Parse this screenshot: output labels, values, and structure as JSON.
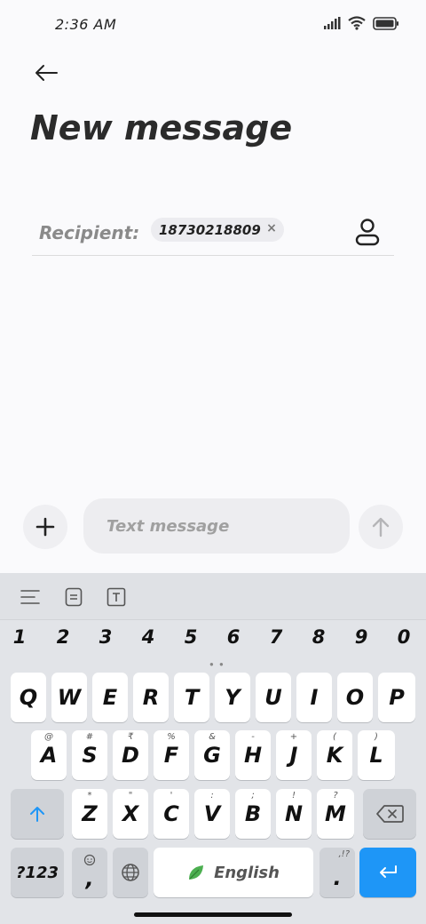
{
  "status_bar": {
    "time": "2:36 AM"
  },
  "header": {
    "title": "New message"
  },
  "recipient": {
    "label": "Recipient:",
    "chip_number": "18730218809",
    "chip_remove": "×"
  },
  "compose": {
    "placeholder": "Text message"
  },
  "keyboard": {
    "numbers": [
      "1",
      "2",
      "3",
      "4",
      "5",
      "6",
      "7",
      "8",
      "9",
      "0"
    ],
    "row1": [
      {
        "k": "Q",
        "s": ""
      },
      {
        "k": "W",
        "s": ""
      },
      {
        "k": "E",
        "s": ""
      },
      {
        "k": "R",
        "s": ""
      },
      {
        "k": "T",
        "s": ""
      },
      {
        "k": "Y",
        "s": ""
      },
      {
        "k": "U",
        "s": ""
      },
      {
        "k": "I",
        "s": ""
      },
      {
        "k": "O",
        "s": ""
      },
      {
        "k": "P",
        "s": ""
      }
    ],
    "row2": [
      {
        "k": "A",
        "s": "@"
      },
      {
        "k": "S",
        "s": "#"
      },
      {
        "k": "D",
        "s": "₹"
      },
      {
        "k": "F",
        "s": "%"
      },
      {
        "k": "G",
        "s": "&"
      },
      {
        "k": "H",
        "s": "-"
      },
      {
        "k": "J",
        "s": "+"
      },
      {
        "k": "K",
        "s": "("
      },
      {
        "k": "L",
        "s": ")"
      }
    ],
    "row3": [
      {
        "k": "Z",
        "s": "*"
      },
      {
        "k": "X",
        "s": "\""
      },
      {
        "k": "C",
        "s": "'"
      },
      {
        "k": "V",
        "s": ":"
      },
      {
        "k": "B",
        "s": ";"
      },
      {
        "k": "N",
        "s": "!"
      },
      {
        "k": "M",
        "s": "?"
      }
    ],
    "symbols_label": "?123",
    "comma": ",",
    "space_label": "English",
    "period": ".",
    "period_sub": ",!?"
  },
  "colors": {
    "accent": "#1e96f7",
    "leaf": "#4caf50"
  }
}
